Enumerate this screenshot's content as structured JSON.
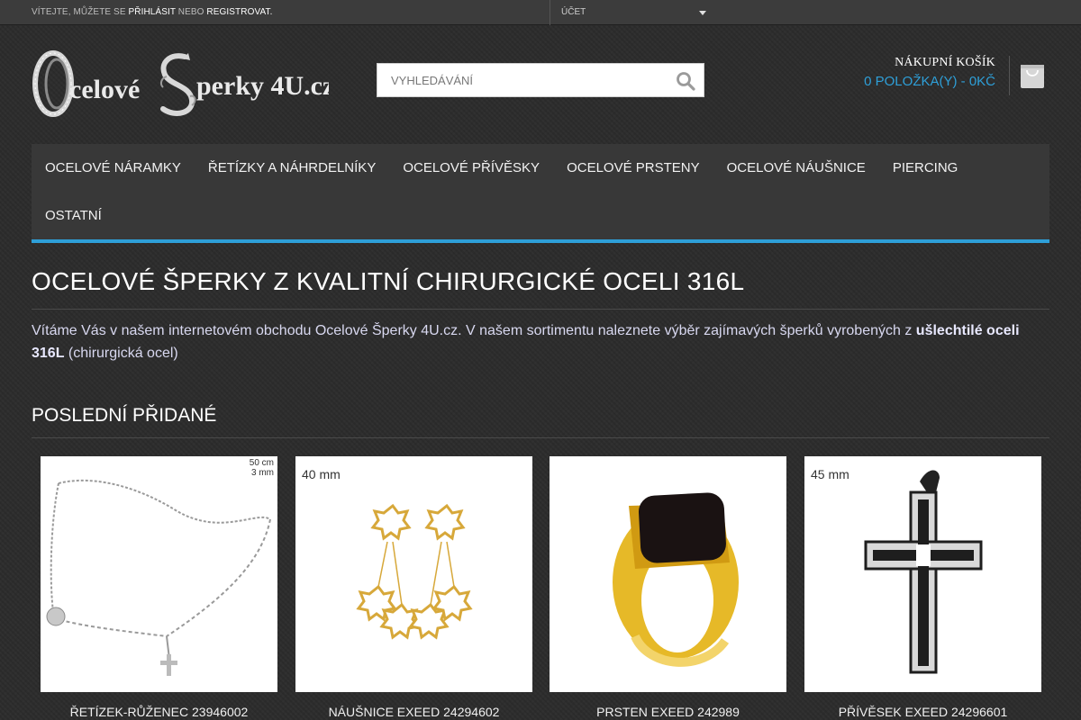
{
  "topbar": {
    "welcome_prefix": "Vítejte, můžete se",
    "login": "přihlásit",
    "or": "nebo",
    "register": "registrovat.",
    "account_label": "Účet"
  },
  "header": {
    "logo_text": "Ocelové Šperky 4U.cz",
    "search_placeholder": "Vyhledávání",
    "cart_title": "Nákupní košík",
    "cart_summary": "0 položka(y) - 0Kč"
  },
  "nav": {
    "items": [
      "Ocelové náramky",
      "Řetízky a náhrdelníky",
      "Ocelové přívěsky",
      "Ocelové prsteny",
      "Ocelové náušnice",
      "Piercing",
      "Ostatní"
    ]
  },
  "content": {
    "title": "Ocelové šperky z kvalitní chirurgické oceli 316L",
    "intro_text": "Vítáme Vás v našem internetovém obchodu Ocelové Šperky 4U.cz. V našem sortimentu naleznete výběr zajímavých šperků vyrobených z ",
    "intro_bold": "ušlechtilé oceli 316L",
    "intro_tail": " (chirurgická ocel)",
    "section_title": "Poslední přidané"
  },
  "products": [
    {
      "name": "Řetízek-Růženec 23946002",
      "dimension": "50 cm",
      "dimension2": "3 mm"
    },
    {
      "name": "Náušnice EXEED 24294602",
      "dimension": "40 mm"
    },
    {
      "name": "Prsten EXEED 242989"
    },
    {
      "name": "Přívěsek EXEED 24296601",
      "dimension": "45 mm"
    }
  ],
  "colors": {
    "accent": "#2e9fd8",
    "background": "#2b2b2b",
    "nav_background": "#383838"
  }
}
